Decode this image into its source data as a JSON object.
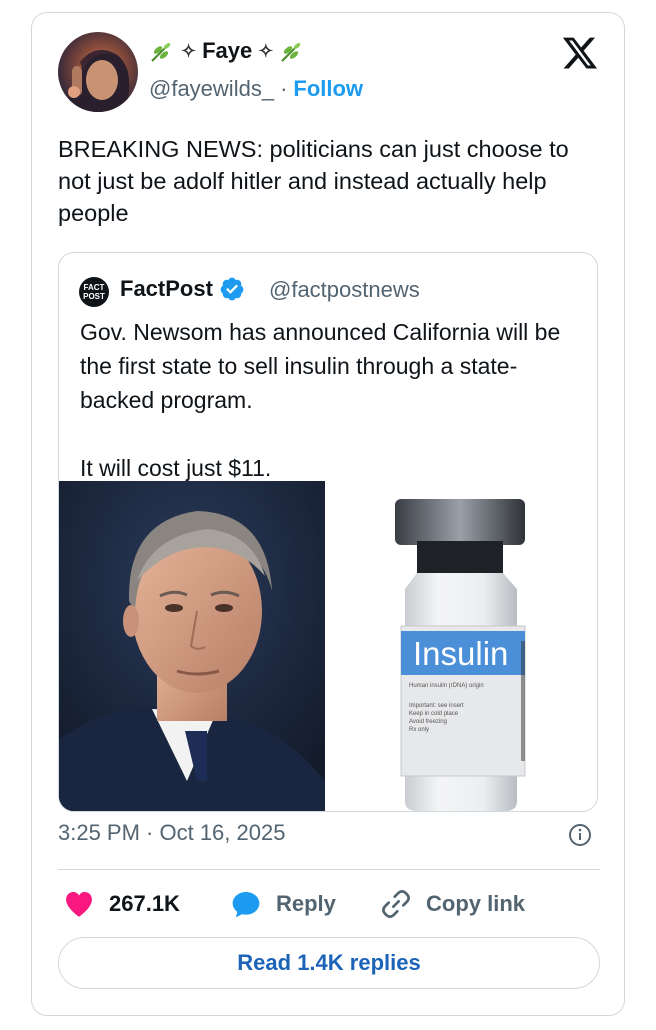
{
  "author": {
    "display_name": "Faye",
    "handle": "@fayewilds_",
    "follow_label": "Follow",
    "name_decor_left": "✧",
    "name_decor_right": "✧"
  },
  "tweet": {
    "text": "BREAKING NEWS: politicians can just choose to not just be adolf hitler and instead actually help people"
  },
  "quoted": {
    "logo_text_1": "FACT",
    "logo_text_2": "POST",
    "name": "FactPost",
    "handle": "@factpostnews",
    "text": "Gov. Newsom has announced California will be the first state to sell insulin through a state-backed program.\n\nIt will cost just $11.",
    "vial_label": "Insulin",
    "vial_subtext": "Human insulin (rDNA) origin",
    "vial_notes": [
      "Important: see insert",
      "Keep in cold place",
      "Avoid freezing",
      "Rx only"
    ]
  },
  "meta": {
    "timestamp": "3:25 PM · Oct 16, 2025"
  },
  "actions": {
    "likes": "267.1K",
    "reply_label": "Reply",
    "copy_label": "Copy link"
  },
  "read_replies_label": "Read 1.4K replies",
  "icons": {
    "brand": "x-logo-icon",
    "like": "heart-icon",
    "reply": "speech-bubble-icon",
    "copy": "link-icon",
    "info": "info-icon",
    "verified": "verified-badge-icon",
    "decor": "leaf-icon"
  },
  "colors": {
    "accent": "#1d9bf0",
    "like": "#f91880",
    "text": "#0f1419",
    "muted": "#536471",
    "border": "#cfd9de"
  }
}
